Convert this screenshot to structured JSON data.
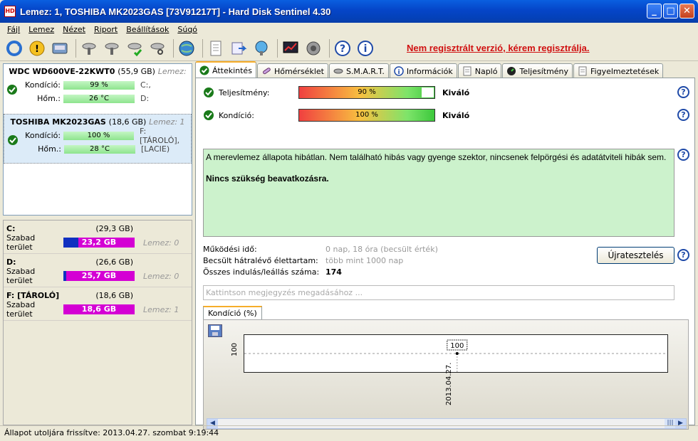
{
  "window": {
    "title": "Lemez: 1, TOSHIBA MK2023GAS [73V91217T]  -  Hard Disk Sentinel 4.30",
    "app_icon": "hds-icon"
  },
  "menu": [
    "Fájl",
    "Lemez",
    "Nézet",
    "Riport",
    "Beállítások",
    "Súgó"
  ],
  "toolbar": {
    "register_text": "Nem regisztrált verzió, kérem regisztrálja."
  },
  "disks": [
    {
      "name": "WDC WD600VE-22KWT0",
      "size": "(55,9 GB)",
      "lemez": "Lemez:",
      "cond_label": "Kondíció:",
      "cond_value": "99 %",
      "temp_label": "Hőm.:",
      "temp_value": "26 °C",
      "drive1": "C:,",
      "drive2": "D:"
    },
    {
      "name": "TOSHIBA MK2023GAS",
      "size": "(18,6 GB)",
      "lemez": "Lemez: 1",
      "cond_label": "Kondíció:",
      "cond_value": "100 %",
      "temp_label": "Hőm.:",
      "temp_value": "28 °C",
      "drive1": "F: [TÁROLÓ],",
      "drive2": "[LACIE)"
    }
  ],
  "volumes": [
    {
      "name": "C:",
      "size": "(29,3 GB)",
      "free_label": "Szabad terület",
      "free": "23,2 GB",
      "used_fraction": 0.21,
      "lemez": "Lemez: 0"
    },
    {
      "name": "D:",
      "size": "(26,6 GB)",
      "free_label": "Szabad terület",
      "free": "25,7 GB",
      "used_fraction": 0.04,
      "lemez": "Lemez: 0"
    },
    {
      "name": "F: [TÁROLÓ]",
      "size": "(18,6 GB)",
      "free_label": "Szabad terület",
      "free": "18,6 GB",
      "used_fraction": 0.0,
      "lemez": "Lemez: 1"
    }
  ],
  "tabs": [
    "Áttekintés",
    "Hőmérséklet",
    "S.M.A.R.T.",
    "Információk",
    "Napló",
    "Teljesítmény",
    "Figyelmeztetések"
  ],
  "overview": {
    "perf_label": "Teljesítmény:",
    "perf_value": "90 %",
    "perf_fraction": 0.9,
    "perf_text": "Kiváló",
    "cond_label": "Kondíció:",
    "cond_value": "100 %",
    "cond_fraction": 1.0,
    "cond_text": "Kiváló",
    "status_text": "A merevlemez állapota hibátlan. Nem található hibás vagy gyenge szektor, nincsenek felpörgési és adatátviteli hibák sem.",
    "status_action": "Nincs szükség beavatkozásra.",
    "uptime_label": "Működési idő:",
    "uptime_value": "0 nap, 18 óra (becsült érték)",
    "life_label": "Becsült hátralévő élettartam:",
    "life_value": "több mint 1000 nap",
    "starts_label": "Összes indulás/leállás száma:",
    "starts_value": "174",
    "reset_button": "Újratesztelés",
    "note_placeholder": "Kattintson megjegyzés megadásához ...",
    "help": "?"
  },
  "chart_data": {
    "type": "line",
    "tab_label": "Kondíció  (%)",
    "x": [
      "2013.04.27."
    ],
    "series": [
      {
        "values": [
          100
        ]
      }
    ],
    "ytick": "100",
    "point_label": "100"
  },
  "statusbar": "Állapot utoljára frissítve: 2013.04.27. szombat 9:19:44"
}
